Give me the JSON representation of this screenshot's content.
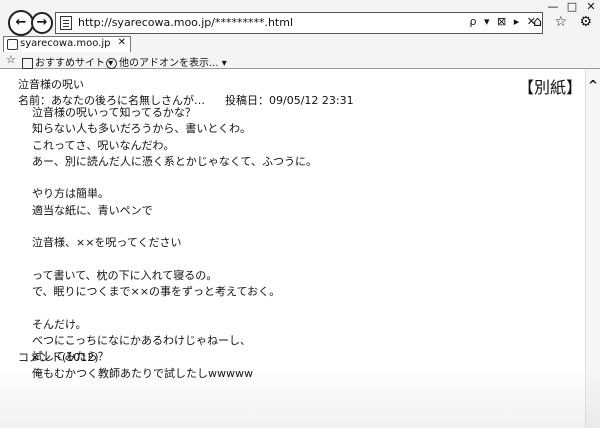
{
  "browser": {
    "url": "http://syarecowa.moo.jp/*********.html",
    "address_tools": "ρ ▾ ⊠ ▸ ✕",
    "tab_title": "syarecowa.moo.jp",
    "tab_close": "✕",
    "window_buttons": [
      "—",
      "□",
      "✕"
    ],
    "right_icons": "⌂ ☆ ⚙",
    "favorites": {
      "star": "☆",
      "item1": "おすすめサイト ▾",
      "item2": "他のアドオンを表示... ▾"
    }
  },
  "post": {
    "title": "泣音様の呪い",
    "author_line": "名前：あなたの後ろに名無しさんが…",
    "date_line": "投稿日：09/05/12 23:31",
    "tag": "【別紙】",
    "lines": [
      "泣音様の呪いって知ってるかな？",
      "知らない人も多いだろうから、書いとくわ。",
      "これってさ、呪いなんだわ。",
      "あー、別に読んだ人に憑く系とかじゃなくて、ふつうに。",
      "",
      "やり方は簡単。",
      "適当な紙に、青いペンで",
      "",
      "泣音様、××を呪ってください",
      "",
      "って書いて、枕の下に入れて寝るの。",
      "で、眠りにつくまで××の事をずっと考えておく。",
      "",
      "そんだけ。",
      "べつにこっちになにかあるわけじゃねーし、",
      "試してみたら？",
      "俺もむかつく教師あたりで試したしwwwww"
    ],
    "comments": "コメント(1012)"
  },
  "scroll_up": "^"
}
